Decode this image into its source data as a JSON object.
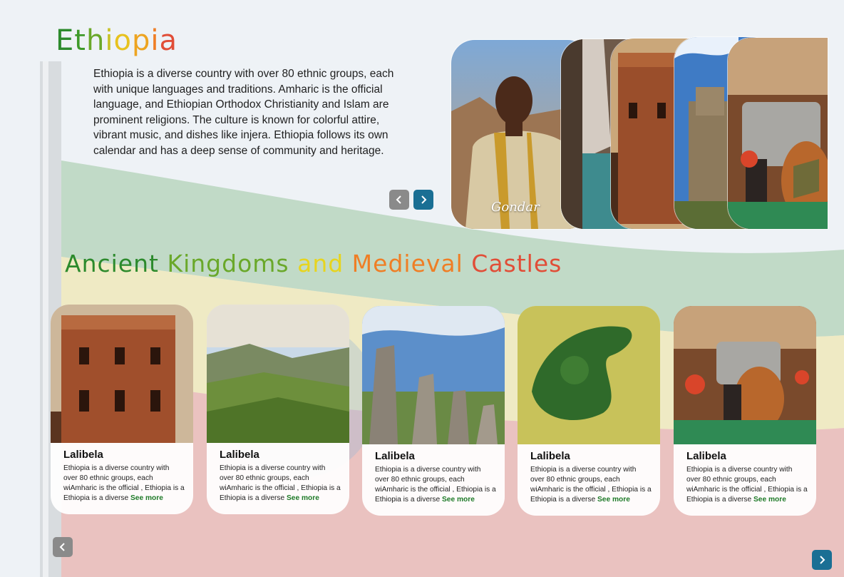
{
  "intro": {
    "title_letters": [
      {
        "ch": "E",
        "color": "#2c8a2c"
      },
      {
        "ch": "t",
        "color": "#3e9a2a"
      },
      {
        "ch": "h",
        "color": "#6aa82a"
      },
      {
        "ch": "i",
        "color": "#c8c228"
      },
      {
        "ch": "o",
        "color": "#e7c21e"
      },
      {
        "ch": "p",
        "color": "#eda421"
      },
      {
        "ch": "i",
        "color": "#ef7e25"
      },
      {
        "ch": "a",
        "color": "#e14d37"
      }
    ],
    "title": "Ethiopia",
    "description": "Ethiopia is a diverse country with over 80 ethnic groups, each with unique languages and traditions. Amharic is the official language, and Ethiopian Orthodox Christianity and Islam are prominent religions. The culture is known for colorful attire, vibrant music, and dishes like injera. Ethiopia follows its own calendar and has a deep sense of community and heritage."
  },
  "gallery": {
    "active_label": "Gondar",
    "prev_icon": "chevron-left-icon",
    "next_icon": "chevron-right-icon"
  },
  "section": {
    "title": "Ancient Kingdoms and Medieval Castles",
    "title_colors": [
      "#2c8a2c",
      "#6aa82a",
      "#e7d41e",
      "#ef7e25",
      "#e14d37"
    ]
  },
  "cards": [
    {
      "title": "Lalibela",
      "body": "Ethiopia is a diverse country with over 80 ethnic groups, each wiAmharic is the official , Ethiopia is a Ethiopia is a diverse",
      "link": "See more",
      "image": "rock-church-image"
    },
    {
      "title": "Lalibela",
      "body": "Ethiopia is a diverse country with over 80 ethnic groups, each wiAmharic is the official , Ethiopia is a Ethiopia is a diverse",
      "link": "See more",
      "image": "highlands-image"
    },
    {
      "title": "Lalibela",
      "body": "Ethiopia is a diverse country with over 80 ethnic groups, each wiAmharic is the official , Ethiopia is a Ethiopia is a diverse",
      "link": "See more",
      "image": "stelae-image"
    },
    {
      "title": "Lalibela",
      "body": "Ethiopia is a diverse country with over 80 ethnic groups, each wiAmharic is the official , Ethiopia is a Ethiopia is a diverse",
      "link": "See more",
      "image": "lake-island-image"
    },
    {
      "title": "Lalibela",
      "body": "Ethiopia is a diverse country with over 80 ethnic groups, each wiAmharic is the official , Ethiopia is a Ethiopia is a diverse",
      "link": "See more",
      "image": "coffee-ceremony-image"
    }
  ],
  "colors": {
    "flag_green": "#2e8b3a",
    "flag_yellow": "#f2d21b",
    "flag_red": "#d8342c",
    "arrow_blue": "#1a6f94",
    "arrow_grey": "#8a8a8a",
    "link_green": "#1e7a28"
  }
}
